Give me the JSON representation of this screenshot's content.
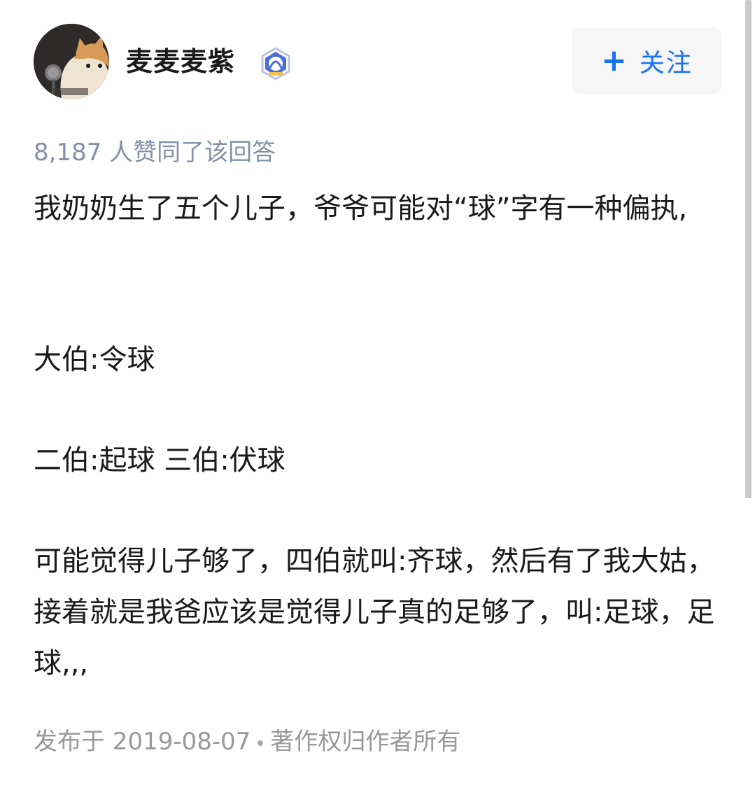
{
  "author": {
    "name": "麦麦麦紫",
    "avatar_icon": "cat-avatar-icon",
    "badge_icon": "badge-icon"
  },
  "follow_button": {
    "icon": "plus-icon",
    "plus": "+",
    "label": "关注",
    "color": "#1772f6"
  },
  "vote_text": "8,187 人赞同了该回答",
  "answer": {
    "paragraphs": [
      "我奶奶生了五个儿子，爷爷可能对“球”字有一种偏执,",
      "大伯:令球",
      "二伯:起球 三伯:伏球",
      "可能觉得儿子够了，四伯就叫:齐球，然后有了我大姑，接着就是我爸应该是觉得儿子真的足够了，叫:足球，足球,,,"
    ]
  },
  "footer": {
    "published": "发布于 2019-08-07",
    "copyright": "著作权归作者所有"
  }
}
